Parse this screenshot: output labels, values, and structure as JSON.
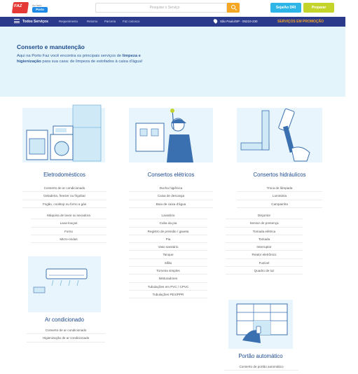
{
  "header": {
    "logo_text": "FAZ",
    "partner_top": "Ao lado",
    "partner_bottom": "Porto",
    "search_placeholder": "Pesquise o Serviço",
    "seja_button": "Seja/Ao DRI",
    "preparar_button": "Preparar"
  },
  "nav": {
    "all_services": "Todos Serviços",
    "links": [
      "Requerimento",
      "Retorno",
      "Parceria",
      "Faz conosco"
    ],
    "location": "São Paulo/SP - 05210-230",
    "promo": "SERVIÇOS EM PROMOÇÃO"
  },
  "hero": {
    "title": "Conserto e manutenção",
    "text_1": "Aqui na Porto Faz você encontra os principais serviços de ",
    "text_bold": "limpeza e higienização",
    "text_2": " para sua casa: de limpeza de estofados à caixa d'água!"
  },
  "categories": [
    {
      "title": "Eletrodomésticos",
      "items": [
        "Conserto de ar condicionado",
        "Geladeira, freezer ou frigobar",
        "Fogão, cooktop ou forno a gás",
        "Máquina de lavar ou secadora",
        "Lava-louças",
        "Forno",
        "Micro-ondas"
      ]
    },
    {
      "title": "Consertos elétricos",
      "items": [
        "Ducha higiênica",
        "Caixa de descarga",
        "Boia de caixa d'água",
        "Lavatório",
        "Cuba da pia",
        "Registro de pressão / gaveta",
        "Pia",
        "Vaso sanitário",
        "Tanque",
        "Sifão",
        "Torneira simples",
        "Misturadores",
        "Tubulações em PVC / CPVC",
        "Tubulações PEX/PPR"
      ]
    },
    {
      "title": "Consertos hidráulicos",
      "items": [
        "Troca de lâmpada",
        "Luminária",
        "Campainha",
        "Disjuntor",
        "Sensor de presença",
        "Tomada elétrica",
        "Tomada",
        "Interruptor",
        "Reator eletrônico",
        "Fusível",
        "Quadro de luz"
      ]
    },
    {
      "title": "Ar condicionado",
      "items": [
        "Conserto de ar condicionado",
        "Higienização de ar condicionado"
      ]
    },
    {
      "title": "Portão automático",
      "items": [
        "Conserto de portão automático"
      ]
    }
  ],
  "colors": {
    "navy": "#2b3a8a",
    "accent_orange": "#f5a623",
    "hero_bg": "#e4f4fb",
    "title_blue": "#1d4a8c",
    "illus_blue": "#cfe9f7"
  }
}
